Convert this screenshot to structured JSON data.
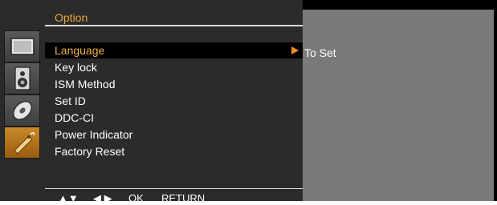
{
  "menu": {
    "title": "Option",
    "items": [
      {
        "label": "Language",
        "selected": true
      },
      {
        "label": "Key lock",
        "selected": false
      },
      {
        "label": "ISM Method",
        "selected": false
      },
      {
        "label": "Set ID",
        "selected": false
      },
      {
        "label": "DDC-CI",
        "selected": false
      },
      {
        "label": "Power Indicator",
        "selected": false
      },
      {
        "label": "Factory Reset",
        "selected": false
      }
    ]
  },
  "submenu": {
    "value": "To Set"
  },
  "icons": [
    {
      "name": "picture-icon"
    },
    {
      "name": "audio-speaker-icon"
    },
    {
      "name": "disc-icon"
    },
    {
      "name": "option-tag-icon",
      "active": true
    }
  ],
  "footer": {
    "updown": "▲▼",
    "leftright": "◀ ▶",
    "ok": "OK",
    "return": "RETURN"
  },
  "colors": {
    "accent": "#e8a63a",
    "arrow": "#f28c1e",
    "panel": "#7a7a7a"
  }
}
